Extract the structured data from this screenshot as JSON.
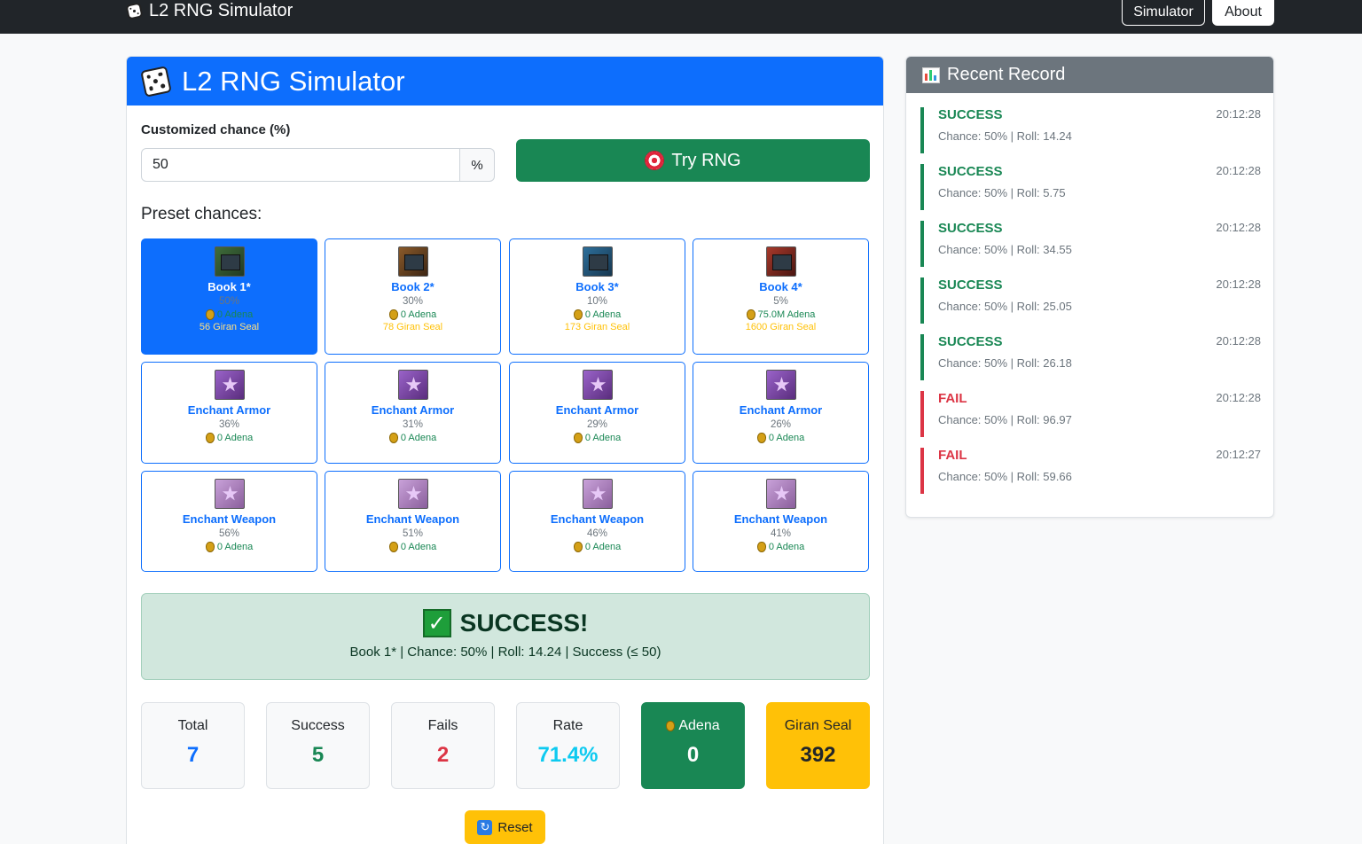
{
  "navbar": {
    "brand": "L2 RNG Simulator",
    "links": [
      {
        "label": "Simulator"
      },
      {
        "label": "About"
      }
    ]
  },
  "main": {
    "title": "L2 RNG Simulator",
    "chance_label": "Customized chance (%)",
    "chance_value": "50",
    "chance_suffix": "%",
    "try_button": "Try RNG",
    "preset_title": "Preset chances:",
    "presets": [
      {
        "name": "Book 1*",
        "chance": "50%",
        "adena": "0 Adena",
        "seal": "56 Giran Seal",
        "icon": "book-icon",
        "active": true
      },
      {
        "name": "Book 2*",
        "chance": "30%",
        "adena": "0 Adena",
        "seal": "78 Giran Seal",
        "icon": "book-icon"
      },
      {
        "name": "Book 3*",
        "chance": "10%",
        "adena": "0 Adena",
        "seal": "173 Giran Seal",
        "icon": "book-icon"
      },
      {
        "name": "Book 4*",
        "chance": "5%",
        "adena": "75.0M Adena",
        "seal": "1600 Giran Seal",
        "icon": "book-icon"
      },
      {
        "name": "Enchant Armor",
        "chance": "36%",
        "adena": "0 Adena",
        "icon": "enchant-armor-scroll-icon"
      },
      {
        "name": "Enchant Armor",
        "chance": "31%",
        "adena": "0 Adena",
        "icon": "enchant-armor-scroll-icon"
      },
      {
        "name": "Enchant Armor",
        "chance": "29%",
        "adena": "0 Adena",
        "icon": "enchant-armor-scroll-icon"
      },
      {
        "name": "Enchant Armor",
        "chance": "26%",
        "adena": "0 Adena",
        "icon": "enchant-armor-scroll-icon"
      },
      {
        "name": "Enchant Weapon",
        "chance": "56%",
        "adena": "0 Adena",
        "icon": "enchant-weapon-scroll-icon"
      },
      {
        "name": "Enchant Weapon",
        "chance": "51%",
        "adena": "0 Adena",
        "icon": "enchant-weapon-scroll-icon"
      },
      {
        "name": "Enchant Weapon",
        "chance": "46%",
        "adena": "0 Adena",
        "icon": "enchant-weapon-scroll-icon"
      },
      {
        "name": "Enchant Weapon",
        "chance": "41%",
        "adena": "0 Adena",
        "icon": "enchant-weapon-scroll-icon"
      }
    ],
    "result": {
      "title": "SUCCESS!",
      "detail": "Book 1* | Chance: 50% | Roll: 14.24 | Success (≤ 50)"
    },
    "stats": [
      {
        "label": "Total",
        "value": "7",
        "color": "#0d6efd"
      },
      {
        "label": "Success",
        "value": "5",
        "color": "#198754"
      },
      {
        "label": "Fails",
        "value": "2",
        "color": "#dc3545"
      },
      {
        "label": "Rate",
        "value": "71.4%",
        "color": "#0dcaf0"
      },
      {
        "label": "Adena",
        "value": "0",
        "color": "#ffffff"
      },
      {
        "label": "Giran Seal",
        "value": "392",
        "color": "#212529"
      }
    ],
    "reset_button": "Reset"
  },
  "record": {
    "title": "Recent Record",
    "items": [
      {
        "status": "SUCCESS",
        "time": "20:12:28",
        "detail": "Chance: 50% | Roll: 14.24"
      },
      {
        "status": "SUCCESS",
        "time": "20:12:28",
        "detail": "Chance: 50% | Roll: 5.75"
      },
      {
        "status": "SUCCESS",
        "time": "20:12:28",
        "detail": "Chance: 50% | Roll: 34.55"
      },
      {
        "status": "SUCCESS",
        "time": "20:12:28",
        "detail": "Chance: 50% | Roll: 25.05"
      },
      {
        "status": "SUCCESS",
        "time": "20:12:28",
        "detail": "Chance: 50% | Roll: 26.18"
      },
      {
        "status": "FAIL",
        "time": "20:12:28",
        "detail": "Chance: 50% | Roll: 96.97"
      },
      {
        "status": "FAIL",
        "time": "20:12:27",
        "detail": "Chance: 50% | Roll: 59.66"
      }
    ]
  }
}
